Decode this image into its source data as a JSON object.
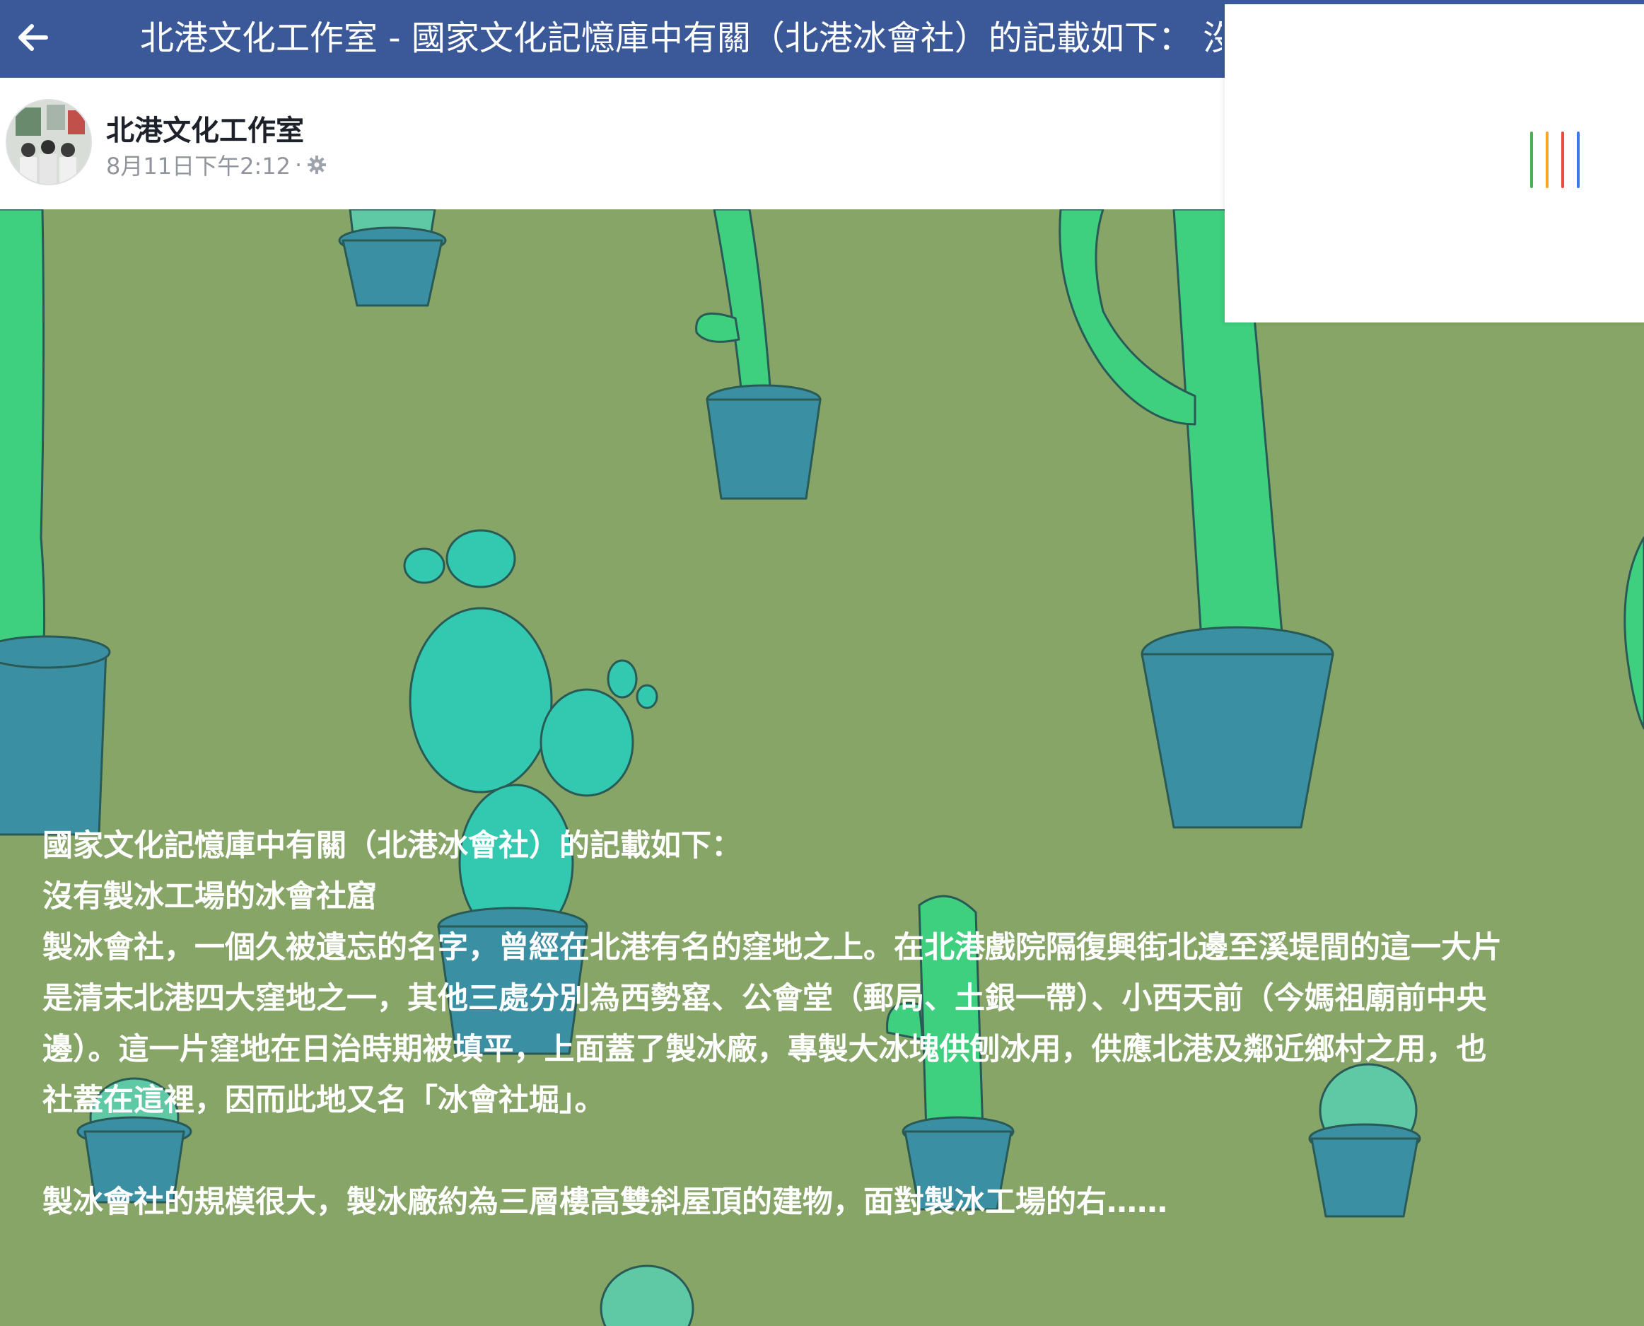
{
  "topbar": {
    "back_icon": "arrow-left-icon",
    "title": "北港文化工作室 - 國家文化記憶庫中有關（北港冰會社）的記載如下： 沒"
  },
  "post": {
    "page_name": "北港文化工作室",
    "timestamp": "8月11日下午2:12",
    "separator": "·",
    "privacy_icon": "gear-icon",
    "lines": [
      "國家文化記憶庫中有關（北港冰會社）的記載如下：",
      "沒有製冰工場的冰會社窟",
      "製冰會社，一個久被遺忘的名字，曾經在北港有名的窪地之上。在北港戲院隔復興街北邊至溪堤間的這一大片",
      "是清末北港四大窪地之一，其他三處分別為西勢窰、公會堂（郵局、土銀一帶）、小西天前（今媽祖廟前中央",
      "邊）。這一片窪地在日治時期被填平，上面蓋了製冰廠，專製大冰塊供刨冰用，供應北港及鄰近鄉村之用，也",
      "社蓋在這裡，因而此地又名「冰會社堀」。",
      "",
      "製冰會社的規模很大，製冰廠約為三層樓高雙斜屋頂的建物，面對製冰工場的右……"
    ]
  },
  "panel": {
    "loader_icon": "loading-bars-icon",
    "loader_colors": [
      "#4caf50",
      "#f5a623",
      "#e74c3c",
      "#3b78e7"
    ]
  },
  "colors": {
    "facebook_blue": "#3b5998",
    "background_green": "#87a566",
    "pot_blue": "#3a8fa3",
    "cactus_green": "#3ecf7f",
    "paddle_cactus": "#33c9b0"
  }
}
